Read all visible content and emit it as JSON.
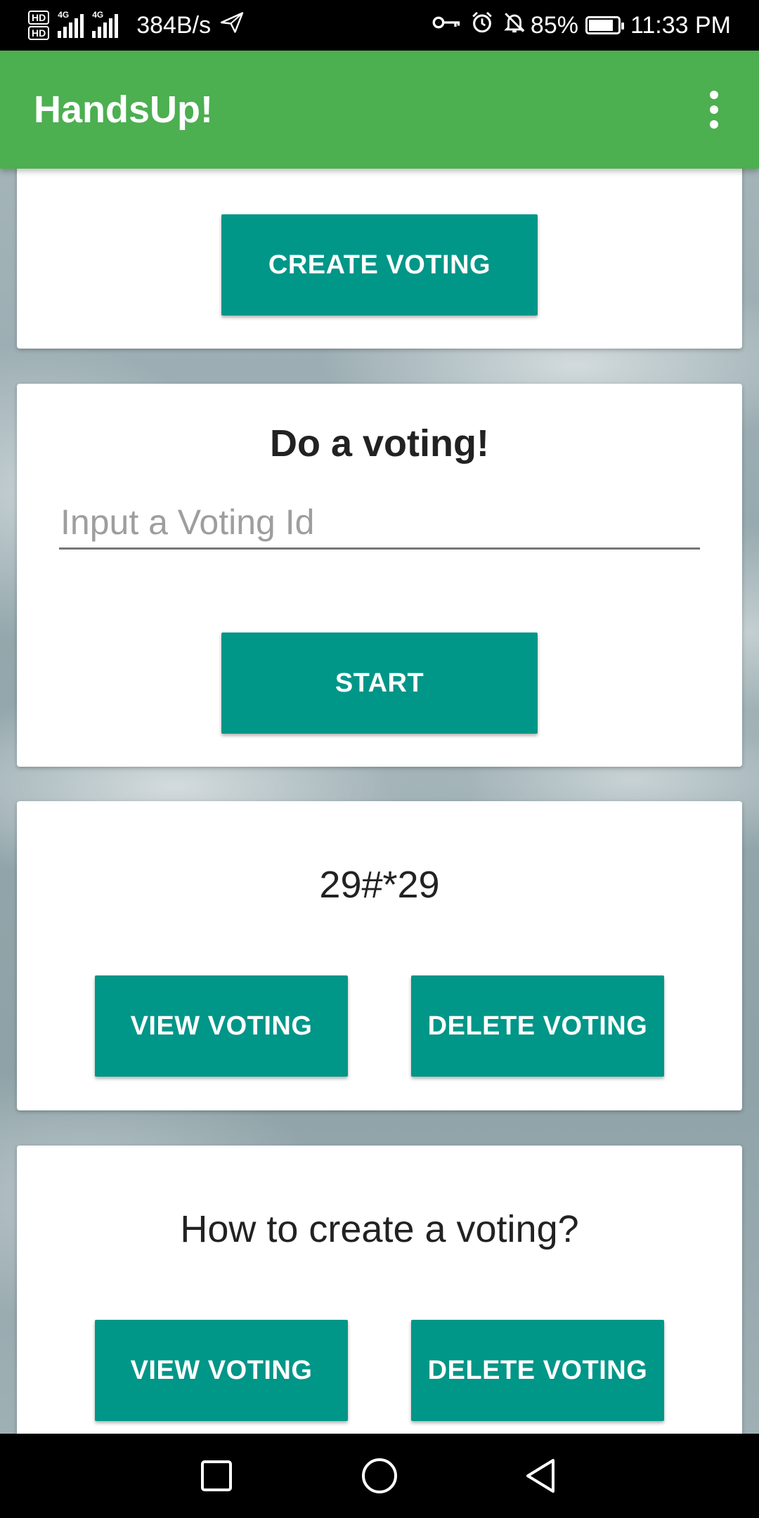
{
  "status_bar": {
    "hd_badges": [
      "HD",
      "HD"
    ],
    "network_labels": [
      "4G",
      "4G"
    ],
    "net_speed": "384B/s",
    "battery_percent": "85%",
    "battery_level": 0.85,
    "time": "11:33 PM",
    "icons": [
      "send-icon",
      "key-icon",
      "alarm-icon",
      "bell-off-icon",
      "battery-icon"
    ]
  },
  "app_bar": {
    "title": "HandsUp!",
    "menu_icon": "more-vert-icon"
  },
  "create_card": {
    "button_label": "CREATE VOTING"
  },
  "do_voting_card": {
    "heading": "Do a voting!",
    "input_placeholder": "Input a Voting Id",
    "input_value": "",
    "button_label": "START"
  },
  "voting_cards": [
    {
      "title": "29#*29",
      "view_label": "VIEW VOTING",
      "delete_label": "DELETE VOTING"
    },
    {
      "title": "How to create a voting?",
      "view_label": "VIEW VOTING",
      "delete_label": "DELETE VOTING"
    }
  ],
  "colors": {
    "app_bar": "#4caf50",
    "button": "#009688",
    "card": "#ffffff"
  },
  "nav_bar": {
    "icons": [
      "square-icon",
      "circle-icon",
      "triangle-back-icon"
    ]
  }
}
